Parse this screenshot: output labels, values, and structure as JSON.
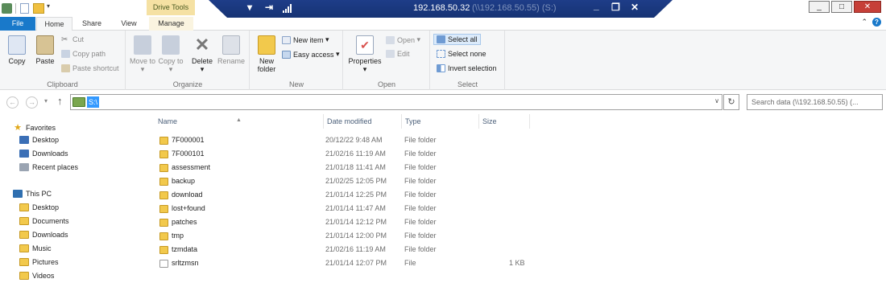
{
  "window": {
    "context_tab": "Drive Tools",
    "remote_host": "192.168.50.32",
    "remote_host_path": "(\\\\192.168.50.55) (S:)",
    "minimize": "_",
    "maximize": "□",
    "close": "✕"
  },
  "tabs": [
    "File",
    "Home",
    "Share",
    "View",
    "Manage"
  ],
  "ribbon": {
    "clipboard": {
      "label": "Clipboard",
      "copy": "Copy",
      "paste": "Paste",
      "cut": "Cut",
      "copy_path": "Copy path",
      "paste_shortcut": "Paste shortcut"
    },
    "organize": {
      "label": "Organize",
      "move_to": "Move to",
      "copy_to": "Copy to",
      "delete": "Delete",
      "rename": "Rename"
    },
    "new": {
      "label": "New",
      "new_folder": "New folder",
      "new_item": "New item",
      "easy_access": "Easy access"
    },
    "open": {
      "label": "Open",
      "properties": "Properties",
      "open": "Open",
      "edit": "Edit"
    },
    "select": {
      "label": "Select",
      "select_all": "Select all",
      "select_none": "Select none",
      "invert": "Invert selection"
    }
  },
  "address": {
    "path": "S:\\",
    "search_placeholder": "Search data (\\\\192.168.50.55) (..."
  },
  "nav": {
    "favorites": "Favorites",
    "fav_items": [
      "Desktop",
      "Downloads",
      "Recent places"
    ],
    "this_pc": "This PC",
    "pc_items": [
      "Desktop",
      "Documents",
      "Downloads",
      "Music",
      "Pictures",
      "Videos"
    ]
  },
  "columns": {
    "name": "Name",
    "date": "Date modified",
    "type": "Type",
    "size": "Size"
  },
  "files": [
    {
      "name": "7F000001",
      "date": "20/12/22 9:48 AM",
      "type": "File folder",
      "size": ""
    },
    {
      "name": "7F000101",
      "date": "21/02/16 11:19 AM",
      "type": "File folder",
      "size": ""
    },
    {
      "name": "assessment",
      "date": "21/01/18 11:41 AM",
      "type": "File folder",
      "size": ""
    },
    {
      "name": "backup",
      "date": "21/02/25 12:05 PM",
      "type": "File folder",
      "size": ""
    },
    {
      "name": "download",
      "date": "21/01/14 12:25 PM",
      "type": "File folder",
      "size": ""
    },
    {
      "name": "lost+found",
      "date": "21/01/14 11:47 AM",
      "type": "File folder",
      "size": ""
    },
    {
      "name": "patches",
      "date": "21/01/14 12:12 PM",
      "type": "File folder",
      "size": ""
    },
    {
      "name": "tmp",
      "date": "21/01/14 12:00 PM",
      "type": "File folder",
      "size": ""
    },
    {
      "name": "tzmdata",
      "date": "21/02/16 11:19 AM",
      "type": "File folder",
      "size": ""
    },
    {
      "name": "srltzmsn",
      "date": "21/01/14 12:07 PM",
      "type": "File",
      "size": "1 KB"
    }
  ],
  "colors": {
    "accent": "#1979ca",
    "remote_bar": "#1e3d88",
    "folder": "#f2c94c",
    "close": "#c63f38"
  }
}
